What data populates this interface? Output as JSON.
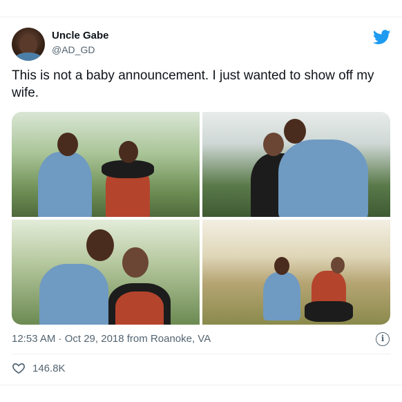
{
  "author": {
    "name": "Uncle Gabe",
    "handle": "@AD_GD"
  },
  "tweet": {
    "text": "This is not a baby announcement. I just wanted to show off my wife."
  },
  "meta": {
    "timestamp": "12:53 AM · Oct 29, 2018 from Roanoke, VA"
  },
  "engagement": {
    "likes": "146.8K"
  },
  "icons": {
    "brand": "twitter-bird-icon",
    "info": "info-icon",
    "like": "heart-icon"
  },
  "colors": {
    "brand": "#1d9bf0",
    "text": "#0f1419",
    "muted": "#536471"
  }
}
